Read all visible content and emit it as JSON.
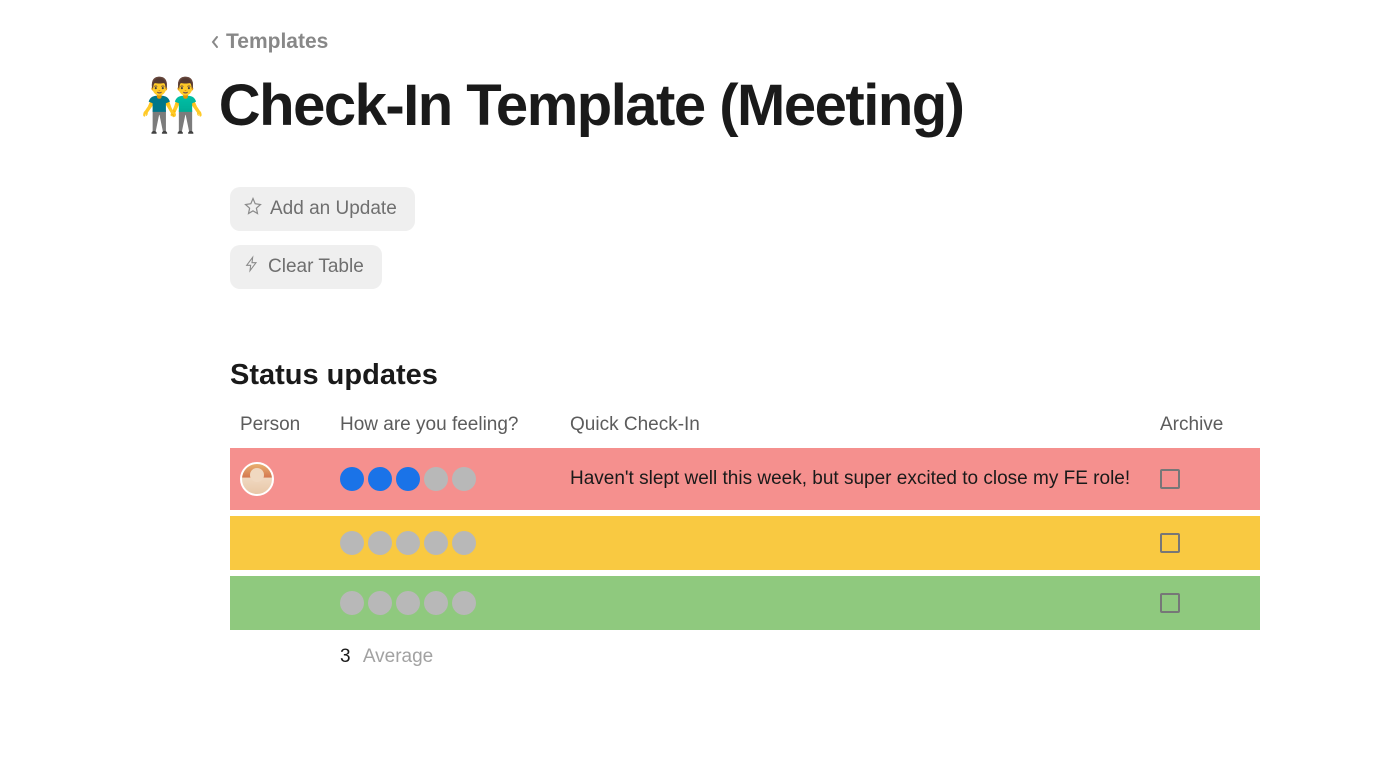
{
  "breadcrumb": {
    "label": "Templates"
  },
  "page": {
    "emoji": "👬",
    "title": "Check-In Template (Meeting)"
  },
  "actions": {
    "add_update": "Add an Update",
    "clear_table": "Clear Table"
  },
  "section": {
    "title": "Status updates"
  },
  "table": {
    "headers": {
      "person": "Person",
      "feeling": "How are you feeling?",
      "checkin": "Quick Check-In",
      "archive": "Archive"
    },
    "rows": [
      {
        "color": "red",
        "has_avatar": true,
        "rating": 3,
        "max_rating": 5,
        "checkin": "Haven't slept well this week, but super excited to close my FE role!",
        "archived": false
      },
      {
        "color": "yellow",
        "has_avatar": false,
        "rating": 0,
        "max_rating": 5,
        "checkin": "",
        "archived": false
      },
      {
        "color": "green",
        "has_avatar": false,
        "rating": 0,
        "max_rating": 5,
        "checkin": "",
        "archived": false
      }
    ],
    "summary": {
      "value": "3",
      "label": "Average"
    }
  }
}
